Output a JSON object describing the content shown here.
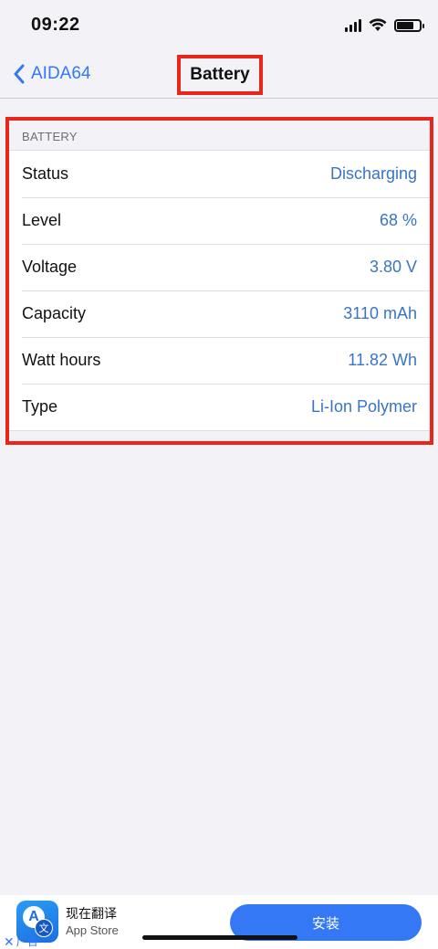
{
  "status_bar": {
    "time": "09:22",
    "icons": [
      "signal-icon",
      "wifi-icon",
      "battery-icon"
    ],
    "battery_level": 0.75
  },
  "nav": {
    "back_label": "AIDA64",
    "title": "Battery"
  },
  "section": {
    "header": "BATTERY",
    "rows": [
      {
        "label": "Status",
        "value": "Discharging"
      },
      {
        "label": "Level",
        "value": "68 %"
      },
      {
        "label": "Voltage",
        "value": "3.80 V"
      },
      {
        "label": "Capacity",
        "value": "3110 mAh"
      },
      {
        "label": "Watt hours",
        "value": "11.82 Wh"
      },
      {
        "label": "Type",
        "value": "Li-Ion Polymer"
      }
    ]
  },
  "ad": {
    "app_name": "现在翻译",
    "store": "App Store",
    "install_label": "安装",
    "ad_label": "广告",
    "icon_letter": "A",
    "icon_char": "文"
  },
  "colors": {
    "accent": "#3478f6",
    "value_text": "#3a74c8",
    "highlight": "#e8261a",
    "background": "#f2f2f7"
  }
}
